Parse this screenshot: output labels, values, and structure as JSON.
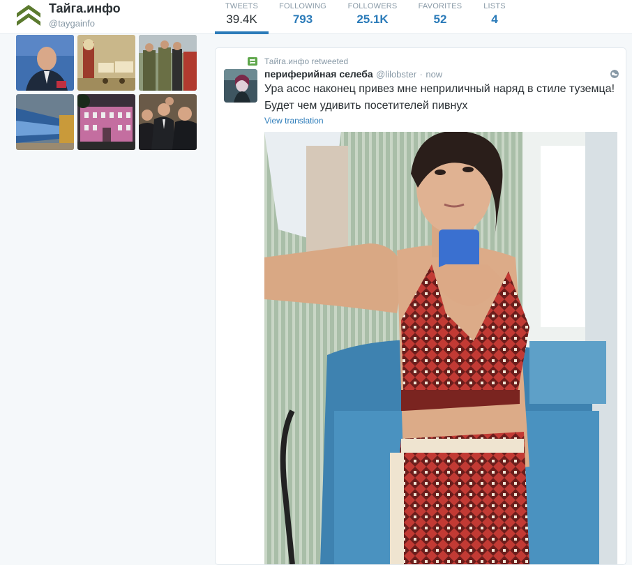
{
  "profile": {
    "name": "Тайга.инфо",
    "handle": "@taygainfo",
    "logo_icon": "chevron-up-double-icon",
    "brand_color": "#5b7a2e"
  },
  "stats": [
    {
      "label": "TWEETS",
      "value": "39.4K",
      "active": true
    },
    {
      "label": "FOLLOWING",
      "value": "793",
      "active": false
    },
    {
      "label": "FOLLOWERS",
      "value": "25.1K",
      "active": false
    },
    {
      "label": "FAVORITES",
      "value": "52",
      "active": false
    },
    {
      "label": "LISTS",
      "value": "4",
      "active": false
    }
  ],
  "photos": [
    {
      "name": "photo-officials-press"
    },
    {
      "name": "photo-cartoon"
    },
    {
      "name": "photo-soldiers"
    },
    {
      "name": "photo-collider-tunnel"
    },
    {
      "name": "photo-pink-building"
    },
    {
      "name": "photo-officials-group"
    }
  ],
  "tweet": {
    "retweeted_by": "Тайга.инфо retweeted",
    "fullname": "периферийная селеба",
    "username": "@lilobster",
    "separator": "·",
    "time": "now",
    "text_line1": "Ура асос наконец привез мне неприличный наряд в стиле туземца!",
    "text_line2": "Будет чем удивить посетителей пивнух",
    "translate_label": "View translation",
    "accent_color": "#2b7bb9",
    "retweet_color": "#5ea64b"
  }
}
